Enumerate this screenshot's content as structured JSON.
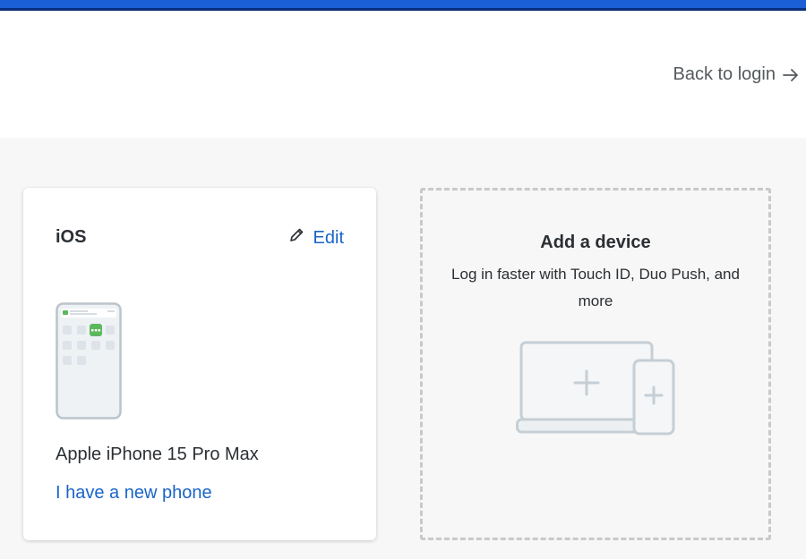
{
  "header": {
    "back_link_label": "Back to login"
  },
  "device": {
    "os": "iOS",
    "edit_label": "Edit",
    "name": "Apple iPhone 15 Pro Max",
    "new_phone_label": "I have a new phone"
  },
  "add_device": {
    "title": "Add a device",
    "subtitle": "Log in faster with Touch ID, Duo Push, and more"
  },
  "colors": {
    "accent_blue": "#1a64c8",
    "top_bar": "#1a5fd6",
    "push_green": "#5cb85c"
  },
  "icons": {
    "back": "arrow-right-icon",
    "edit": "pencil-icon",
    "phone": "phone-illustration",
    "add_device": "laptop-phone-plus-illustration"
  }
}
